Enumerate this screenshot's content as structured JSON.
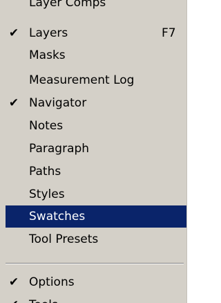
{
  "menu": {
    "items": [
      {
        "label": "Layer Comps",
        "checked": false,
        "shortcut": "",
        "state": "partially-visible-top"
      },
      {
        "label": "Layers",
        "checked": true,
        "shortcut": "F7"
      },
      {
        "label": "Masks",
        "checked": false,
        "shortcut": ""
      },
      {
        "label": "Measurement Log",
        "checked": false,
        "shortcut": ""
      },
      {
        "label": "Navigator",
        "checked": true,
        "shortcut": ""
      },
      {
        "label": "Notes",
        "checked": false,
        "shortcut": ""
      },
      {
        "label": "Paragraph",
        "checked": false,
        "shortcut": ""
      },
      {
        "label": "Paths",
        "checked": false,
        "shortcut": ""
      },
      {
        "label": "Styles",
        "checked": false,
        "shortcut": ""
      },
      {
        "label": "Swatches",
        "checked": false,
        "shortcut": "",
        "state": "highlighted"
      },
      {
        "label": "Tool Presets",
        "checked": false,
        "shortcut": ""
      },
      {
        "label": "Options",
        "checked": true,
        "shortcut": ""
      },
      {
        "label": "Tools",
        "checked": true,
        "shortcut": "",
        "state": "partially-visible-bottom"
      }
    ],
    "check_glyph": "✔",
    "colors": {
      "menu_background": "#d4d0c8",
      "highlight_background": "#0a246a",
      "highlight_text": "#ffffff",
      "text": "#000000"
    }
  }
}
